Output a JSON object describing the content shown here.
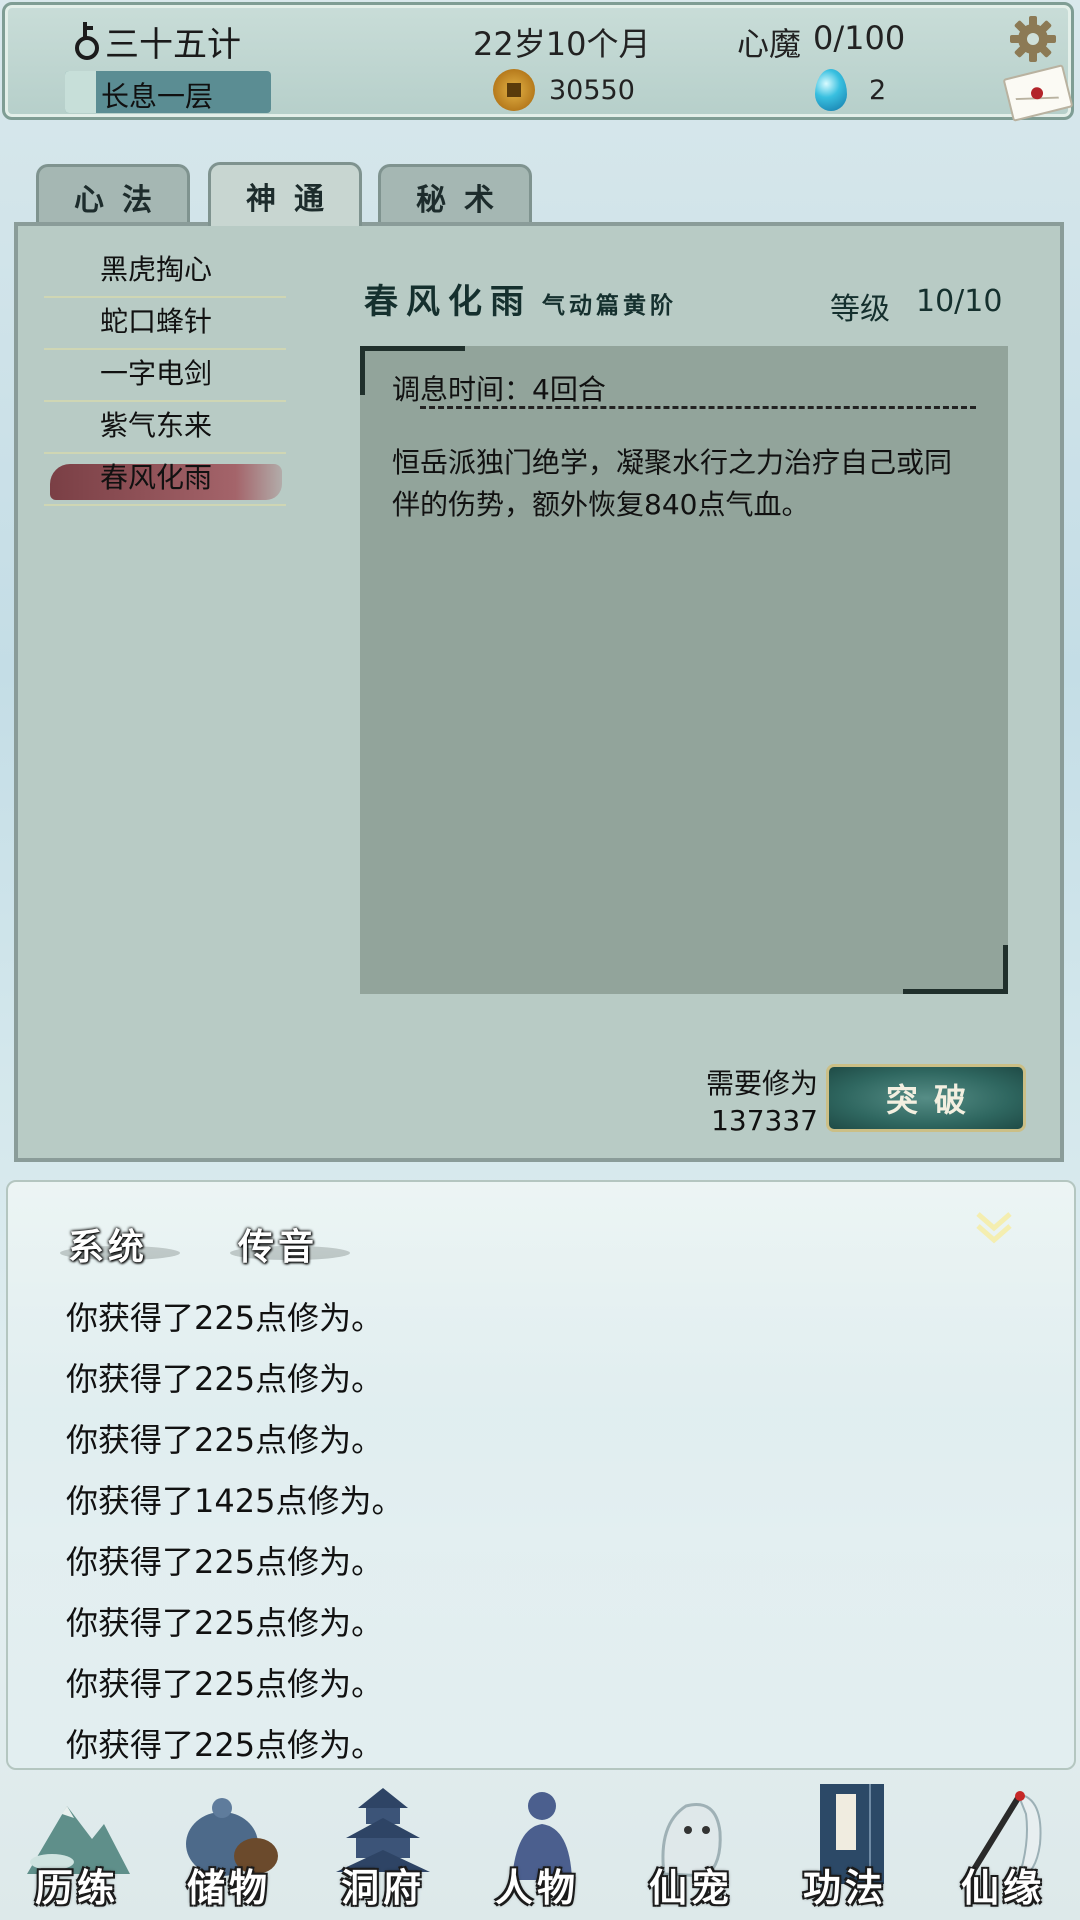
{
  "status": {
    "player_name": "三十五计",
    "realm": "长息一层",
    "realm_progress": 0.15,
    "age": "22岁10个月",
    "coins": "30550",
    "heart_demon_label": "心魔",
    "heart_demon_value": "0/100",
    "gems": "2"
  },
  "tabs": [
    {
      "label": "心法",
      "active": false
    },
    {
      "label": "神通",
      "active": true
    },
    {
      "label": "秘术",
      "active": false
    }
  ],
  "skills": [
    {
      "label": "黑虎掏心"
    },
    {
      "label": "蛇口蜂针"
    },
    {
      "label": "一字电剑"
    },
    {
      "label": "紫气东来"
    },
    {
      "label": "春风化雨",
      "selected": true
    }
  ],
  "detail": {
    "name": "春风化雨",
    "subtitle": "气动篇黄阶",
    "level_label": "等级",
    "level_value": "10/10",
    "cooldown": "调息时间：4回合",
    "description": "恒岳派独门绝学，凝聚水行之力治疗自己或同伴的伤势，额外恢复840点气血。",
    "need_label": "需要修为",
    "need_value": "137337",
    "break_button": "突破"
  },
  "log": {
    "tabs": [
      "系统",
      "传音"
    ],
    "lines": [
      "你获得了225点修为。",
      "你获得了225点修为。",
      "你获得了225点修为。",
      "你获得了1425点修为。",
      "你获得了225点修为。",
      "你获得了225点修为。",
      "你获得了225点修为。",
      "你获得了225点修为。"
    ]
  },
  "nav": [
    {
      "label": "历练",
      "icon": "mountain-icon"
    },
    {
      "label": "储物",
      "icon": "bag-icon"
    },
    {
      "label": "洞府",
      "icon": "pagoda-icon"
    },
    {
      "label": "人物",
      "icon": "person-icon"
    },
    {
      "label": "仙宠",
      "icon": "pet-icon"
    },
    {
      "label": "功法",
      "icon": "scroll-book-icon",
      "active": true
    },
    {
      "label": "仙缘",
      "icon": "crane-icon"
    }
  ]
}
